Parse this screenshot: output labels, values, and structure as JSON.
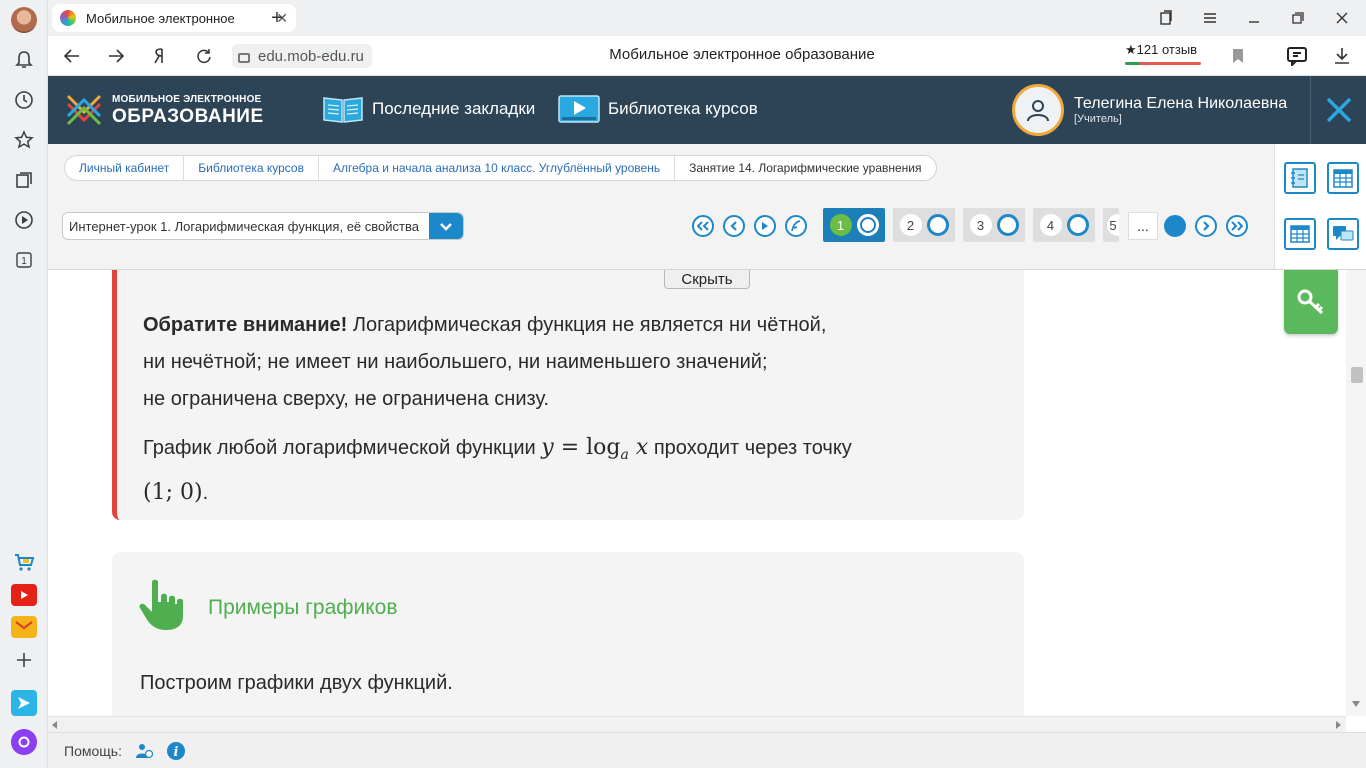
{
  "browser": {
    "tab_title": "Мобильное электронное",
    "url": "edu.mob-edu.ru",
    "page_title": "Мобильное электронное образование",
    "reviews": "★121 отзыв",
    "new_tab": "+",
    "tab_close": "✕"
  },
  "header": {
    "logo_line1": "МОБИЛЬНОЕ ЭЛЕКТРОННОЕ",
    "logo_line2": "ОБРАЗОВАНИЕ",
    "bookmarks_label": "Последние закладки",
    "library_label": "Библиотека курсов",
    "user_name": "Телегина Елена Николаевна",
    "user_role": "[Учитель]"
  },
  "breadcrumb": [
    "Личный кабинет",
    "Библиотека курсов",
    "Алгебра и начала анализа 10 класс. Углублённый уровень",
    "Занятие 14. Логарифмические уравнения"
  ],
  "lesson_select": "Интернет-урок 1. Логарифмическая функция, её свойства",
  "steps": [
    {
      "num": "1",
      "active": true
    },
    {
      "num": "2",
      "active": false
    },
    {
      "num": "3",
      "active": false
    },
    {
      "num": "4",
      "active": false
    },
    {
      "num": "5",
      "active": false
    }
  ],
  "more_label": "...",
  "content": {
    "hide_label": "Скрыть",
    "note_bold": "Обратите внимание!",
    "note_line1": " Логарифмическая функция не является ни чётной,",
    "note_line2": "ни нечётной; не имеет ни наибольшего, ни наименьшего значений;",
    "note_line3": "не ограничена сверху, не ограничена снизу.",
    "graph_text_before": "График любой логарифмической функции ",
    "graph_formula_y": "y",
    "graph_formula_eq": " = log",
    "graph_formula_sub": "a",
    "graph_formula_x": " x",
    "graph_text_after": " проходит через точку",
    "graph_point": "(1; 0)",
    "graph_point_end": ".",
    "examples_title": "Примеры графиков",
    "examples_text": "Построим графики двух функций."
  },
  "status": {
    "help_label": "Помощь:"
  },
  "colors": {
    "header_bg": "#2d4356",
    "accent_blue": "#1d88c9",
    "accent_green": "#5cb85c",
    "note_border": "#e0453a"
  }
}
